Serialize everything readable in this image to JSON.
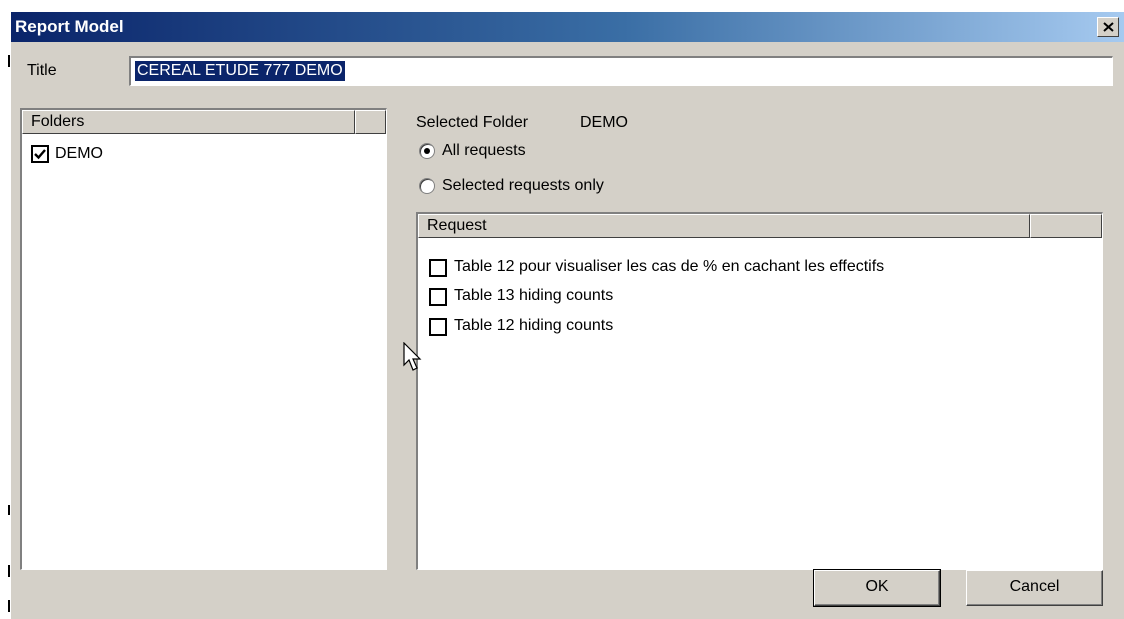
{
  "window": {
    "title": "Report Model",
    "close_symbol": "close-icon"
  },
  "title_field": {
    "label": "Title",
    "value": "CEREAL ETUDE 777 DEMO"
  },
  "folders": {
    "header": "Folders",
    "items": [
      {
        "label": "DEMO",
        "checked": true
      }
    ]
  },
  "selected_folder": {
    "label": "Selected Folder",
    "value": "DEMO"
  },
  "scope": {
    "options": [
      {
        "label": "All requests",
        "selected": true
      },
      {
        "label": "Selected requests only",
        "selected": false
      }
    ]
  },
  "requests": {
    "header": "Request",
    "items": [
      {
        "label": "Table 12 pour visualiser les cas de % en cachant les effectifs",
        "checked": false
      },
      {
        "label": "Table 13 hiding counts",
        "checked": false
      },
      {
        "label": "Table 12  hiding counts",
        "checked": false
      }
    ]
  },
  "buttons": {
    "ok": "OK",
    "cancel": "Cancel"
  },
  "colors": {
    "titlebar_start": "#0a246a",
    "titlebar_end": "#a6caf0",
    "dialog_bg": "#d4d0c8",
    "selection": "#0a246a"
  },
  "cursor": {
    "icon": "arrow-cursor-icon"
  }
}
